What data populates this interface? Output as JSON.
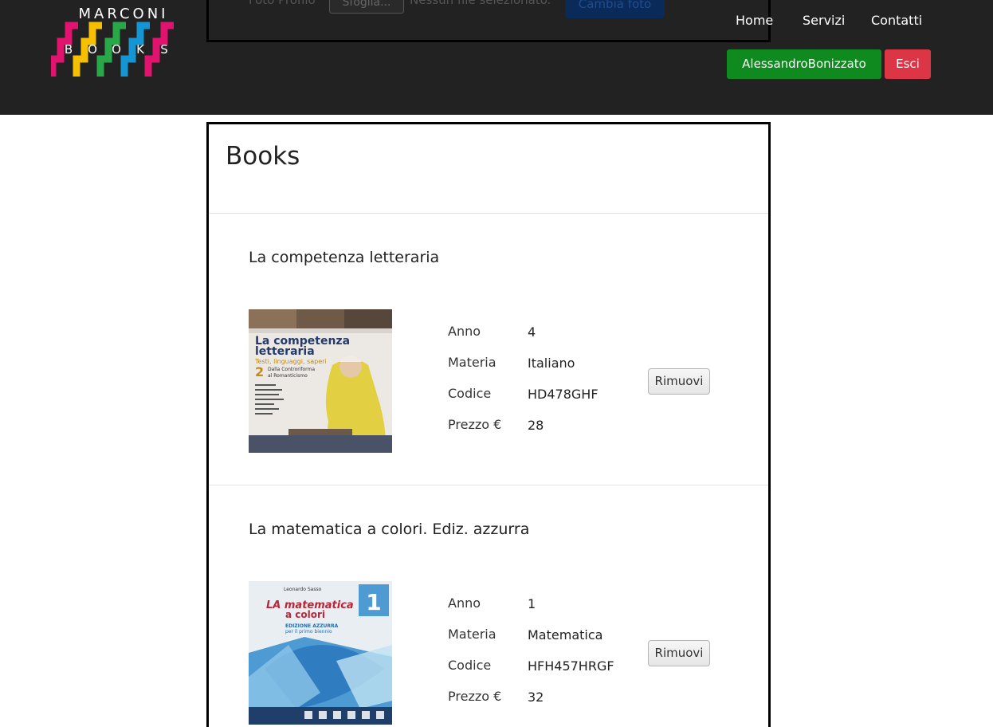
{
  "brand": {
    "title": "MARCONI",
    "subtitle_letters": [
      "B",
      "O",
      "O",
      "K",
      "S"
    ],
    "colors": [
      "#e2136e",
      "#f6c000",
      "#29a84a",
      "#1496d4",
      "#e2136e"
    ]
  },
  "upload": {
    "label": "Foto Profilo",
    "browse_label": "Sfoglia...",
    "status": "Nessun file selezionato.",
    "submit_label": "Cambia foto"
  },
  "nav": {
    "home": "Home",
    "services": "Servizi",
    "contacts": "Contatti",
    "user": "AlessandroBonizzato",
    "logout": "Esci"
  },
  "page": {
    "title": "Books"
  },
  "books": [
    {
      "title": "La competenza letteraria",
      "cover": {
        "title_line1": "La competenza",
        "title_line2": "letteraria",
        "tagline": "Testi, linguaggi, saperi",
        "volume": "2",
        "subtitle_line1": "Dalla Controriforma",
        "subtitle_line2": "al Romanticismo"
      },
      "labels": {
        "year": "Anno",
        "subject": "Materia",
        "code": "Codice",
        "price": "Prezzo €"
      },
      "year": "4",
      "subject": "Italiano",
      "code": "HD478GHF",
      "price": "28",
      "remove_label": "Rimuovi"
    },
    {
      "title": "La matematica a colori. Ediz. azzurra",
      "cover": {
        "author": "Leonardo Sasso",
        "title_line1": "LA matematica",
        "title_line2": "a colori",
        "edition_line1": "EDIZIONE AZZURRA",
        "edition_line2": "per il primo biennio",
        "volume": "1"
      },
      "labels": {
        "year": "Anno",
        "subject": "Materia",
        "code": "Codice",
        "price": "Prezzo €"
      },
      "year": "1",
      "subject": "Matematica",
      "code": "HFH457HRGF",
      "price": "32",
      "remove_label": "Rimuovi"
    }
  ]
}
